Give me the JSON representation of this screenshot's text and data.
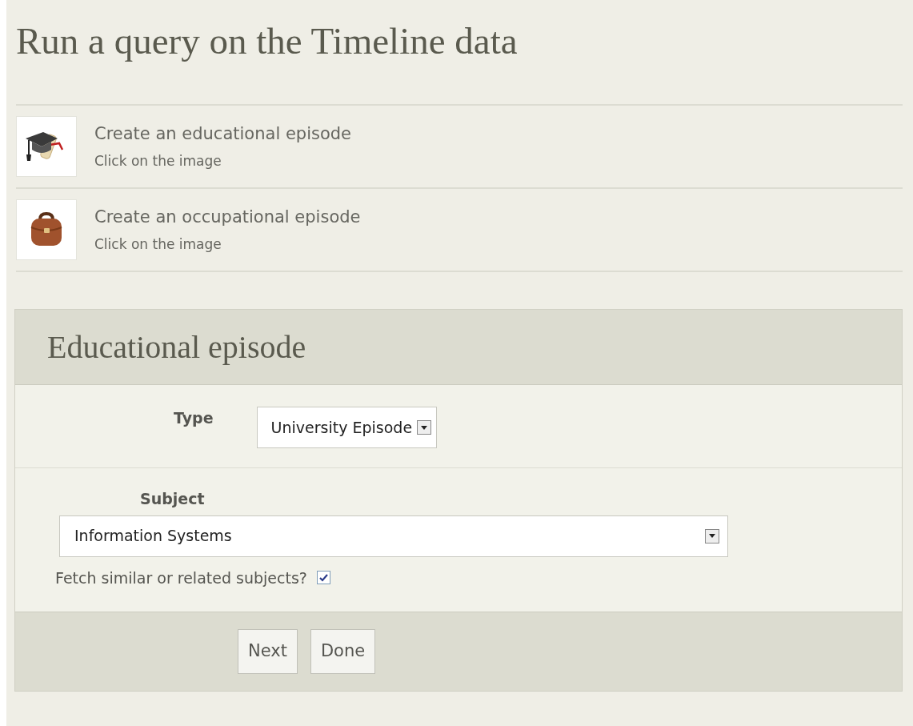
{
  "page": {
    "title": "Run a query on the Timeline data"
  },
  "episode_options": [
    {
      "kind": "education",
      "label": "Create an educational episode",
      "hint": "Click on the image"
    },
    {
      "kind": "occupation",
      "label": "Create an occupational episode",
      "hint": "Click on the image"
    }
  ],
  "form": {
    "title": "Educational episode",
    "type": {
      "label": "Type",
      "value": "University Episode"
    },
    "subject": {
      "label": "Subject",
      "value": "Information Systems"
    },
    "related": {
      "label": "Fetch similar or related subjects?",
      "checked": true
    },
    "buttons": [
      "Next",
      "Done"
    ]
  }
}
